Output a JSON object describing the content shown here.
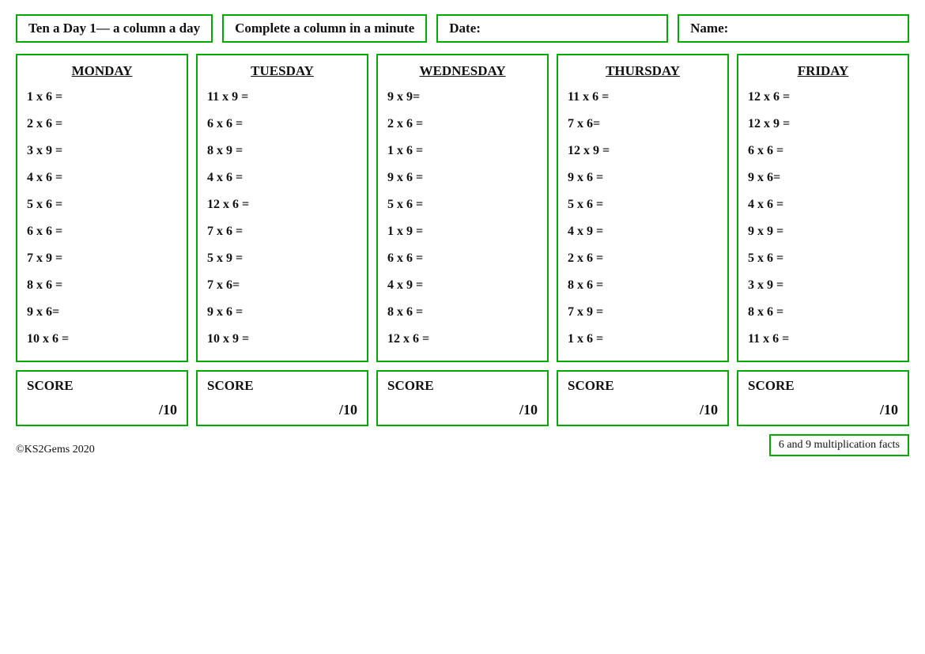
{
  "header": {
    "title": "Ten a Day 1— a column a day",
    "complete": "Complete a column in a minute",
    "date_label": "Date:",
    "name_label": "Name:"
  },
  "days": [
    {
      "name": "MONDAY",
      "problems": [
        "1 x 6 =",
        "2 x 6 =",
        "3 x 9 =",
        "4 x 6 =",
        "5 x 6 =",
        "6 x 6 =",
        "7 x 9 =",
        "8 x 6 =",
        "9 x 6=",
        "10 x 6 ="
      ]
    },
    {
      "name": "TUESDAY",
      "problems": [
        "11 x 9 =",
        "6 x 6 =",
        "8 x 9 =",
        "4 x 6 =",
        "12 x 6 =",
        "7 x 6 =",
        "5 x 9 =",
        "7 x 6=",
        "9 x 6 =",
        "10 x 9 ="
      ]
    },
    {
      "name": "WEDNESDAY",
      "problems": [
        "9 x 9=",
        "2 x 6 =",
        "1 x 6 =",
        "9 x 6 =",
        "5 x 6 =",
        "1 x 9 =",
        "6 x 6 =",
        "4 x 9 =",
        "8 x 6 =",
        "12 x 6 ="
      ]
    },
    {
      "name": "THURSDAY",
      "problems": [
        "11 x 6 =",
        "7 x 6=",
        "12 x 9 =",
        "9 x 6 =",
        "5 x 6 =",
        "4 x 9 =",
        "2 x 6 =",
        "8 x 6 =",
        "7 x 9 =",
        "1 x 6 ="
      ]
    },
    {
      "name": "FRIDAY",
      "problems": [
        "12 x 6 =",
        "12 x 9 =",
        "6 x 6 =",
        "9 x 6=",
        "4 x 6 =",
        "9 x 9 =",
        "5 x 6 =",
        "3 x 9 =",
        "8 x 6 =",
        "11 x 6 ="
      ]
    }
  ],
  "score": {
    "label": "SCORE",
    "value": "/10"
  },
  "footer": {
    "copyright": "©KS2Gems 2020",
    "facts": "6 and 9 multiplication facts"
  }
}
